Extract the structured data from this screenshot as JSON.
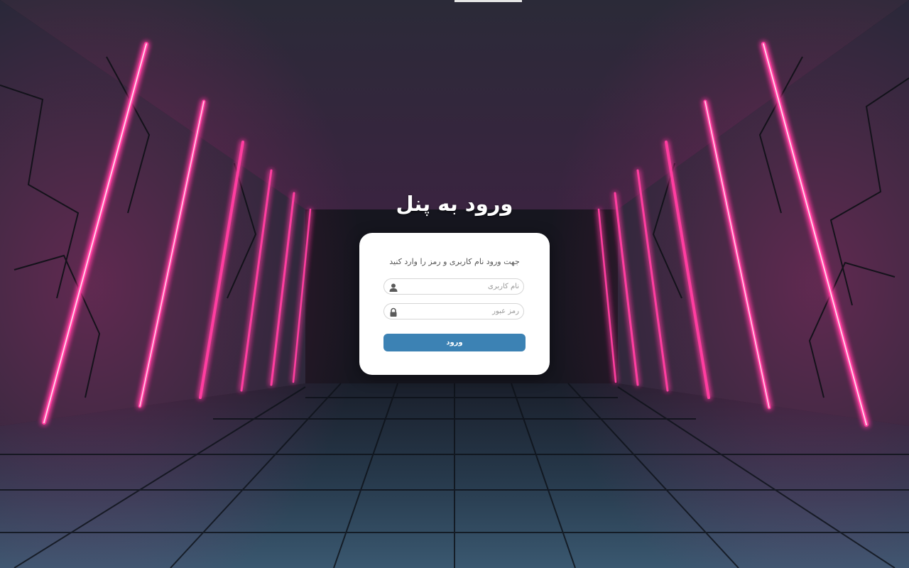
{
  "page": {
    "title": "ورود به پنل"
  },
  "login_form": {
    "subtitle": "جهت ورود نام کاربری و رمز را وارد کنید",
    "username": {
      "placeholder": "نام کاربری",
      "value": "",
      "icon": "user-icon"
    },
    "password": {
      "placeholder": "رمز عبور",
      "value": "",
      "icon": "lock-icon"
    },
    "submit_label": "ورود"
  },
  "colors": {
    "neon": "#ff2d95",
    "button": "#3c82b4",
    "card_bg": "#ffffff",
    "title_text": "#ffffff"
  }
}
